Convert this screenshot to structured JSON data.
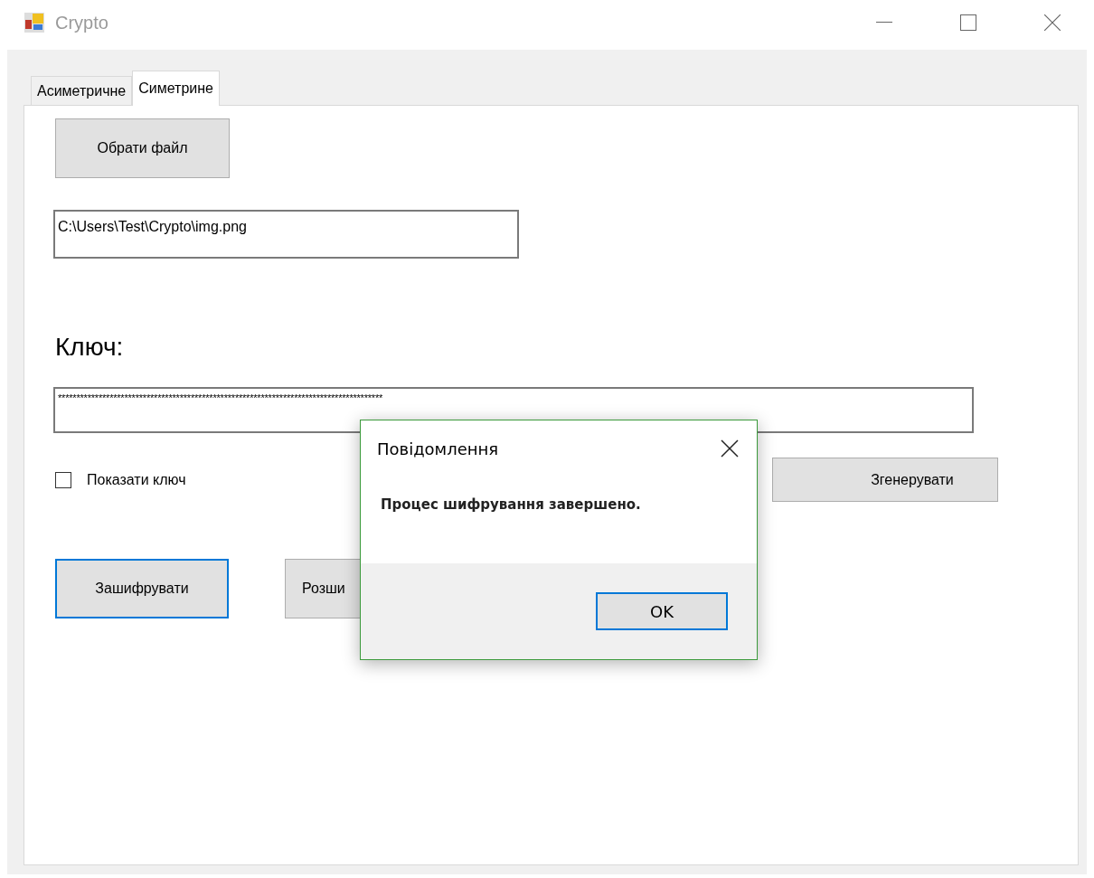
{
  "window": {
    "title": "Crypto"
  },
  "tabs": [
    {
      "label": "Асиметричне",
      "selected": false
    },
    {
      "label": "Симетрине",
      "selected": true
    }
  ],
  "choose_file_button": "Обрати файл",
  "file_path": {
    "value": "C:\\Users\\Test\\Crypto\\img.png"
  },
  "key_label": "Ключ:",
  "key_field": {
    "value": "****************************************************************************************"
  },
  "show_key": {
    "label": "Показати ключ",
    "checked": false
  },
  "generate_button": "Згенерувати",
  "encrypt_button": {
    "label": "Зашифрувати",
    "focused": true
  },
  "decrypt_button": {
    "label": "Розши",
    "focused": false
  },
  "dialog": {
    "title": "Повідомлення",
    "message": "Процес шифрування завершено.",
    "ok_button": "OK"
  }
}
